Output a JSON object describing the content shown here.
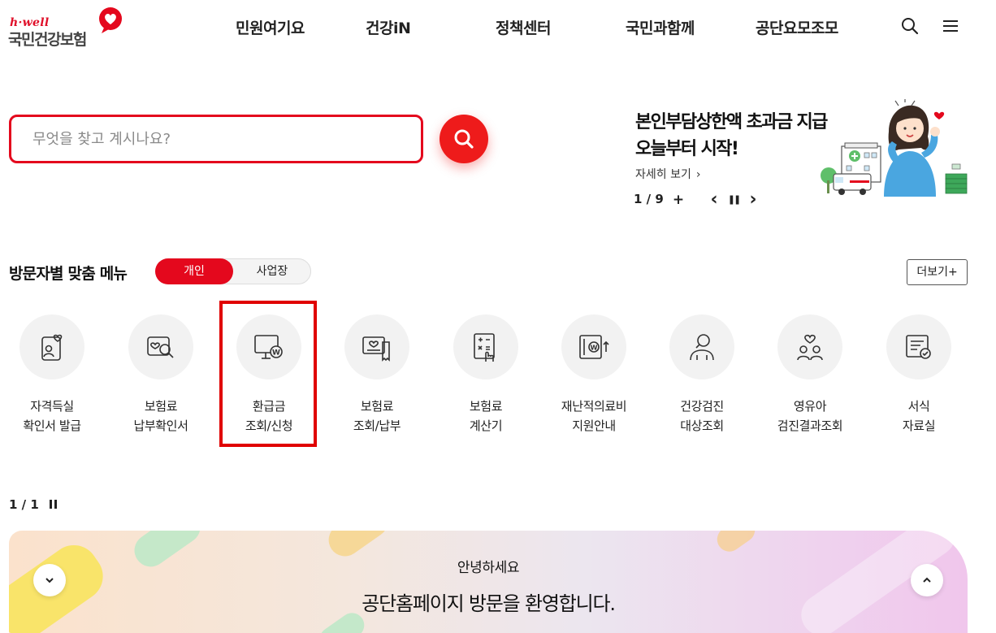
{
  "brand": {
    "tagline": "h·well",
    "name": "국민건강보험",
    "accent_color": "#e4081d"
  },
  "nav": {
    "items": [
      "민원여기요",
      "건강iN",
      "정책센터",
      "국민과함께",
      "공단요모조모"
    ],
    "search_icon": "search-icon",
    "menu_icon": "hamburger-menu-icon"
  },
  "search": {
    "placeholder": "무엇을 찾고 계시나요?",
    "value": ""
  },
  "promo": {
    "title_line1": "본인부담상한액 초과금 지급",
    "title_line2": "오늘부터 시작!",
    "more_label": "자세히 보기",
    "counter": "1 / 9",
    "plus_label": "+",
    "prev_label": "‹",
    "pause_label": "❚❚",
    "next_label": "›"
  },
  "menu": {
    "title": "방문자별 맞춤 메뉴",
    "tabs": [
      {
        "label": "개인",
        "active": true
      },
      {
        "label": "사업장",
        "active": false
      }
    ],
    "more_label": "더보기+",
    "items": [
      {
        "label": "자격득실\n확인서 발급",
        "icon": "id-card-heart-icon"
      },
      {
        "label": "보험료\n납부확인서",
        "icon": "document-search-icon"
      },
      {
        "label": "환급금\n조회/신청",
        "icon": "monitor-won-icon",
        "highlighted": true
      },
      {
        "label": "보험료\n조회/납부",
        "icon": "bill-heart-icon"
      },
      {
        "label": "보험료\n계산기",
        "icon": "calculator-hand-icon"
      },
      {
        "label": "재난적의료비\n지원안내",
        "icon": "wallet-won-arrow-icon"
      },
      {
        "label": "건강검진\n대상조회",
        "icon": "person-search-icon"
      },
      {
        "label": "영유아\n검진결과조회",
        "icon": "family-heart-icon"
      },
      {
        "label": "서식\n자료실",
        "icon": "form-check-icon"
      }
    ],
    "page_indicator": "1 / 1"
  },
  "welcome": {
    "hello": "안녕하세요",
    "main": "공단홈페이지 방문을 환영합니다."
  }
}
